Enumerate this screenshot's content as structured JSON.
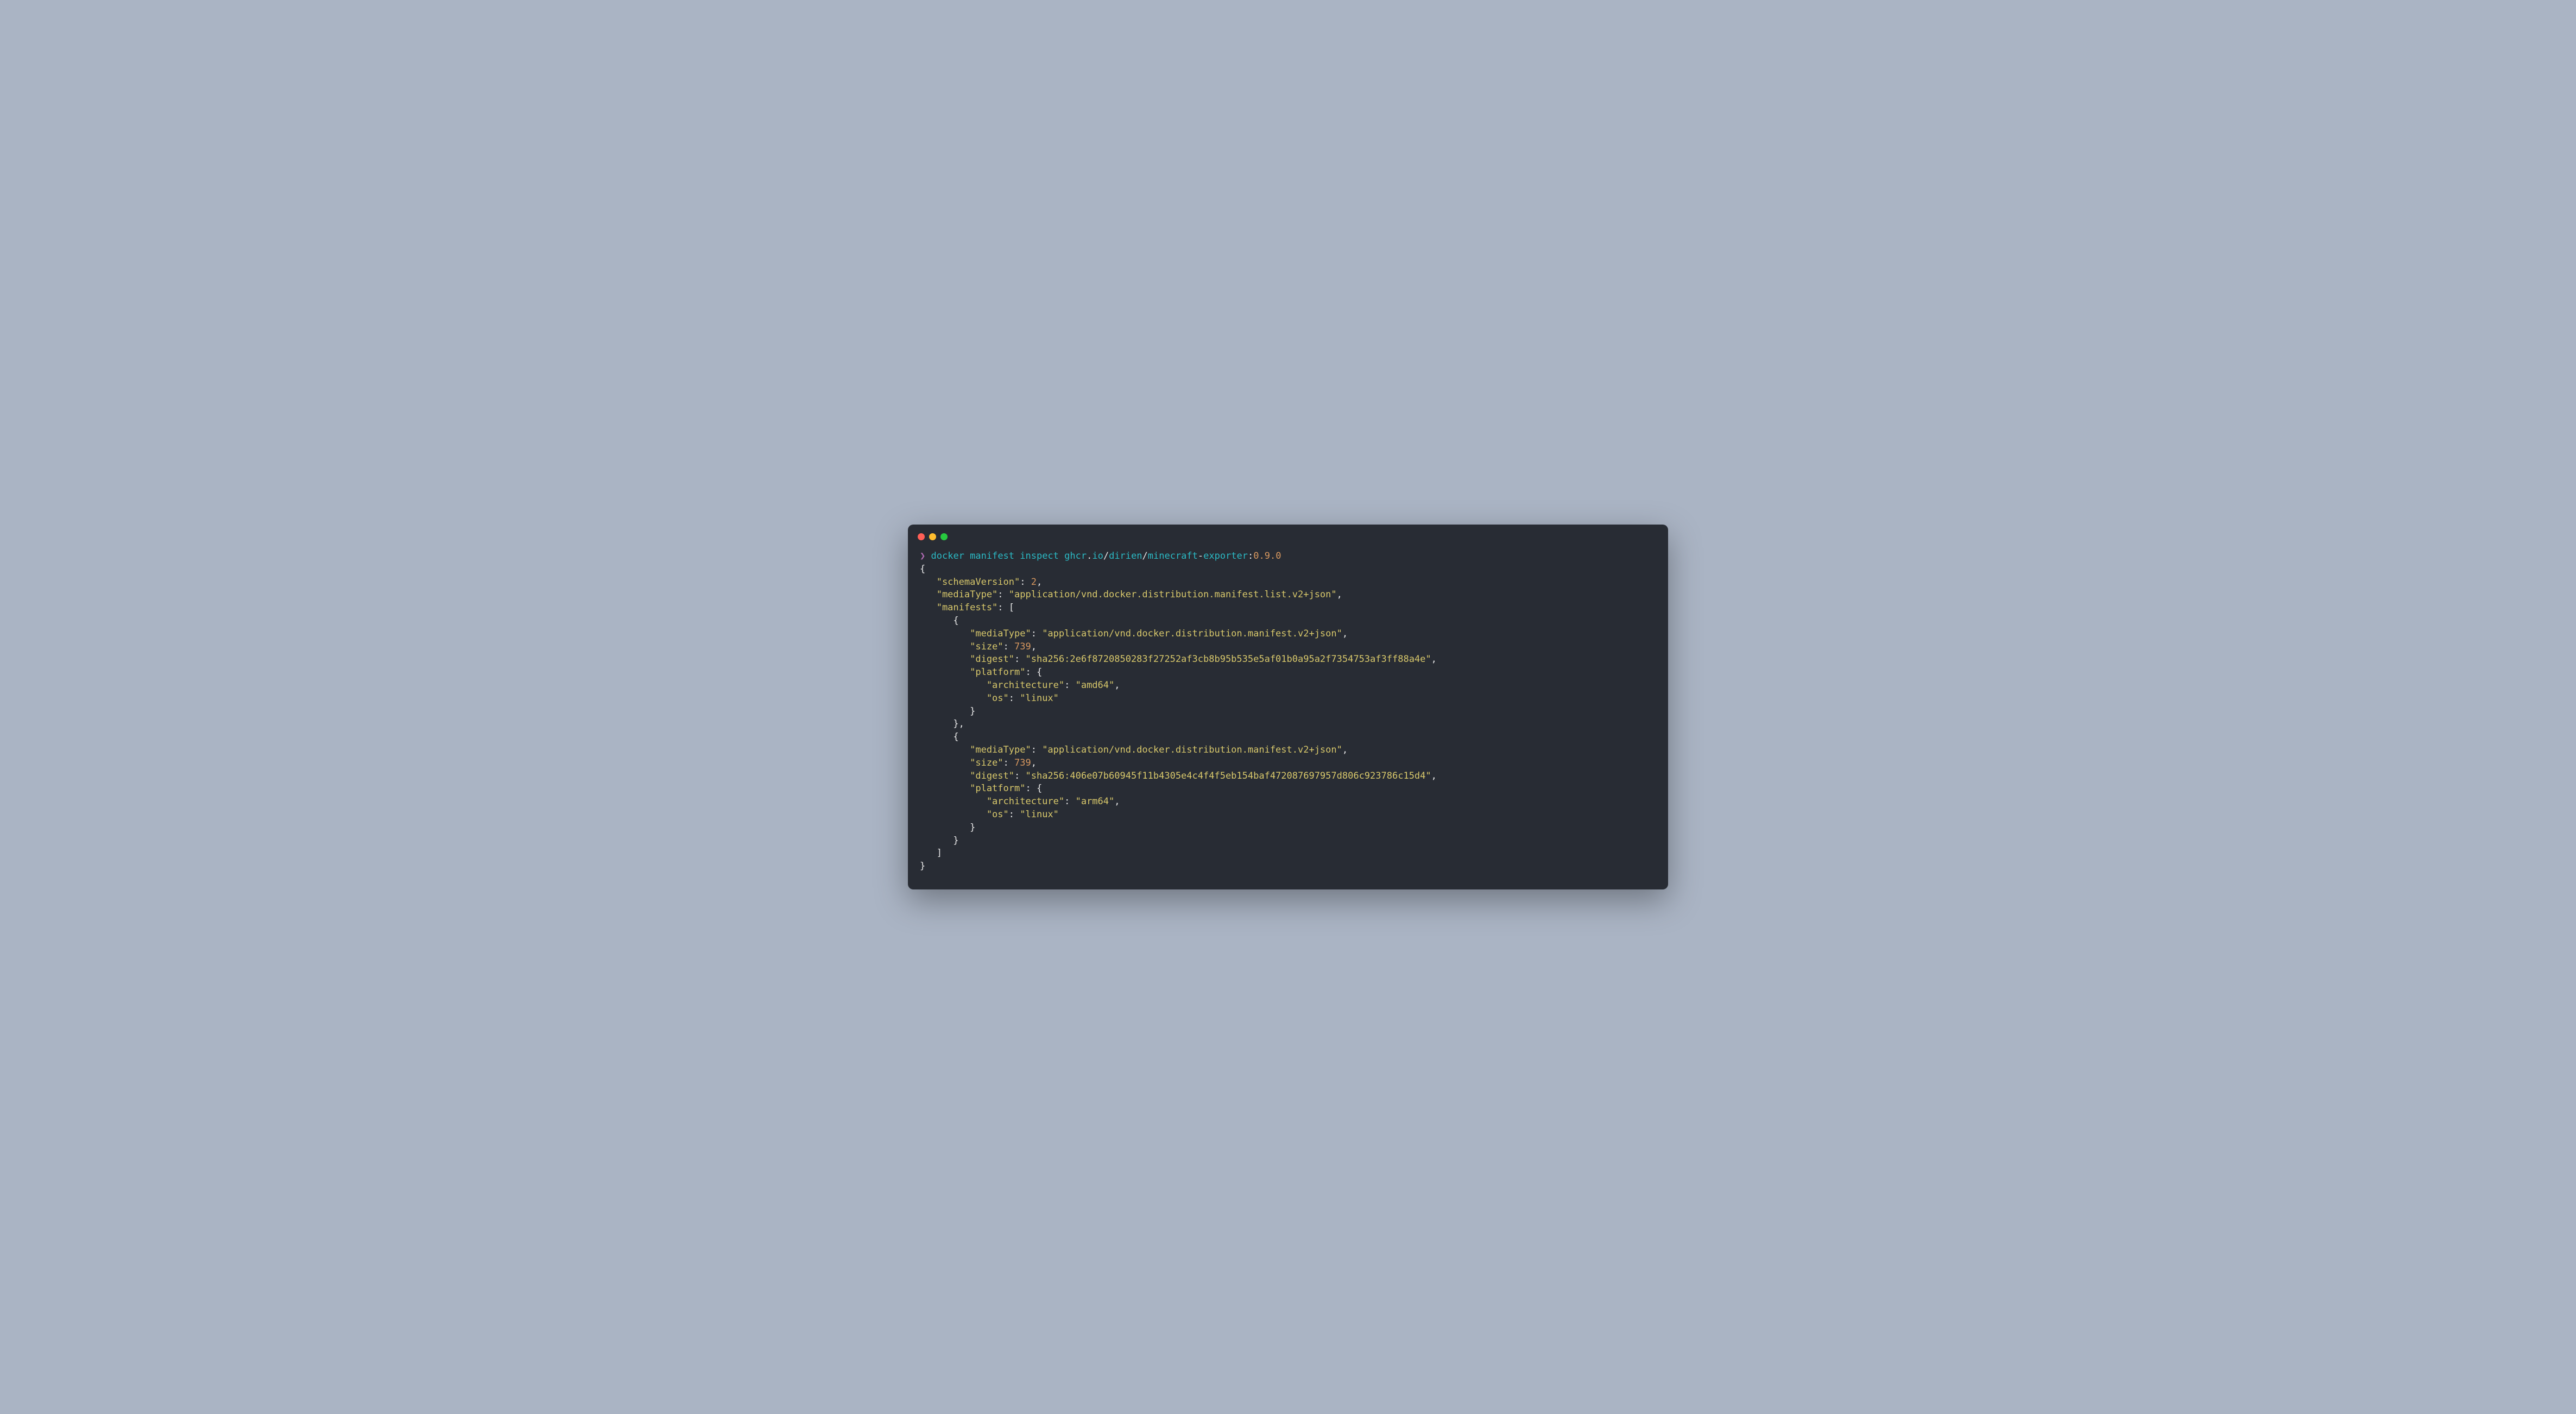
{
  "prompt": "❯",
  "command": {
    "bin": "docker manifest inspect ",
    "registry": "ghcr",
    "dot1": ".",
    "tld": "io",
    "slash1": "/",
    "user": "dirien",
    "slash2": "/",
    "repo1": "minecraft",
    "dash": "-",
    "repo2": "exporter",
    "colon": ":",
    "tag": "0.9.0"
  },
  "json": {
    "l1": "{",
    "l2_key": "   \"schemaVersion\"",
    "l2_sep": ": ",
    "l2_val": "2",
    "l2_end": ",",
    "l3_key": "   \"mediaType\"",
    "l3_sep": ": ",
    "l3_val": "\"application/vnd.docker.distribution.manifest.list.v2+json\"",
    "l3_end": ",",
    "l4_key": "   \"manifests\"",
    "l4_sep": ": [",
    "l5": "      {",
    "l6_key": "         \"mediaType\"",
    "l6_sep": ": ",
    "l6_val": "\"application/vnd.docker.distribution.manifest.v2+json\"",
    "l6_end": ",",
    "l7_key": "         \"size\"",
    "l7_sep": ": ",
    "l7_val": "739",
    "l7_end": ",",
    "l8_key": "         \"digest\"",
    "l8_sep": ": ",
    "l8_val": "\"sha256:2e6f8720850283f27252af3cb8b95b535e5af01b0a95a2f7354753af3ff88a4e\"",
    "l8_end": ",",
    "l9_key": "         \"platform\"",
    "l9_sep": ": {",
    "l10_key": "            \"architecture\"",
    "l10_sep": ": ",
    "l10_val": "\"amd64\"",
    "l10_end": ",",
    "l11_key": "            \"os\"",
    "l11_sep": ": ",
    "l11_val": "\"linux\"",
    "l12": "         }",
    "l13": "      },",
    "l14": "      {",
    "l15_key": "         \"mediaType\"",
    "l15_sep": ": ",
    "l15_val": "\"application/vnd.docker.distribution.manifest.v2+json\"",
    "l15_end": ",",
    "l16_key": "         \"size\"",
    "l16_sep": ": ",
    "l16_val": "739",
    "l16_end": ",",
    "l17_key": "         \"digest\"",
    "l17_sep": ": ",
    "l17_val": "\"sha256:406e07b60945f11b4305e4c4f4f5eb154baf472087697957d806c923786c15d4\"",
    "l17_end": ",",
    "l18_key": "         \"platform\"",
    "l18_sep": ": {",
    "l19_key": "            \"architecture\"",
    "l19_sep": ": ",
    "l19_val": "\"arm64\"",
    "l19_end": ",",
    "l20_key": "            \"os\"",
    "l20_sep": ": ",
    "l20_val": "\"linux\"",
    "l21": "         }",
    "l22": "      }",
    "l23": "   ]",
    "l24": "}"
  }
}
